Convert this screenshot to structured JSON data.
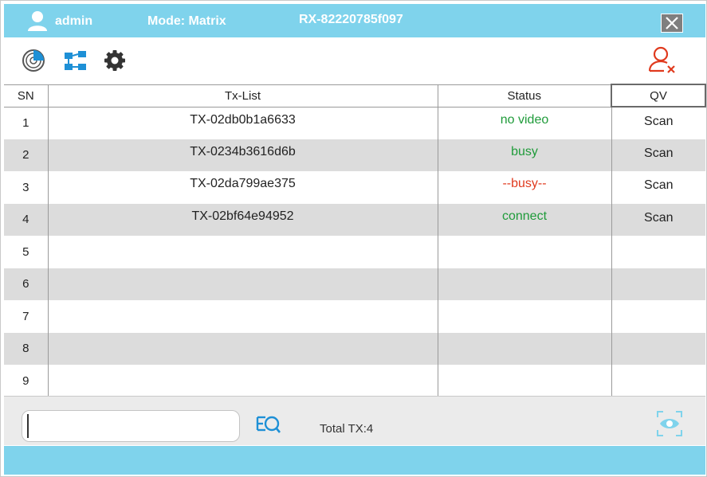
{
  "header": {
    "user": "admin",
    "mode": "Mode: Matrix",
    "rx_id": "RX-82220785f097",
    "close_icon": "close-icon"
  },
  "toolbar": {
    "icons": [
      "radar-scan-icon",
      "topology-icon",
      "gear-icon"
    ],
    "logout_icon": "user-remove-icon"
  },
  "table": {
    "columns": [
      "SN",
      "Tx-List",
      "Status",
      "QV"
    ],
    "rows": [
      {
        "sn": "1",
        "tx": "TX-02db0b1a6633",
        "status": "no video",
        "status_color": "#1f9b3a",
        "qv": "Scan"
      },
      {
        "sn": "2",
        "tx": "TX-0234b3616d6b",
        "status": "busy",
        "status_color": "#1f9b3a",
        "qv": "Scan"
      },
      {
        "sn": "3",
        "tx": "TX-02da799ae375",
        "status": "--busy--",
        "status_color": "#e03a1e",
        "qv": "Scan"
      },
      {
        "sn": "4",
        "tx": "TX-02bf64e94952",
        "status": "connect",
        "status_color": "#1f9b3a",
        "qv": "Scan"
      },
      {
        "sn": "5",
        "tx": "",
        "status": "",
        "qv": ""
      },
      {
        "sn": "6",
        "tx": "",
        "status": "",
        "qv": ""
      },
      {
        "sn": "7",
        "tx": "",
        "status": "",
        "qv": ""
      },
      {
        "sn": "8",
        "tx": "",
        "status": "",
        "qv": ""
      },
      {
        "sn": "9",
        "tx": "",
        "status": "",
        "qv": ""
      }
    ]
  },
  "footer": {
    "search_value": "",
    "total": "Total TX:4"
  },
  "colors": {
    "accent": "#7fd3ec",
    "icon_blue": "#1e90d6",
    "alert_red": "#e03a1e"
  }
}
